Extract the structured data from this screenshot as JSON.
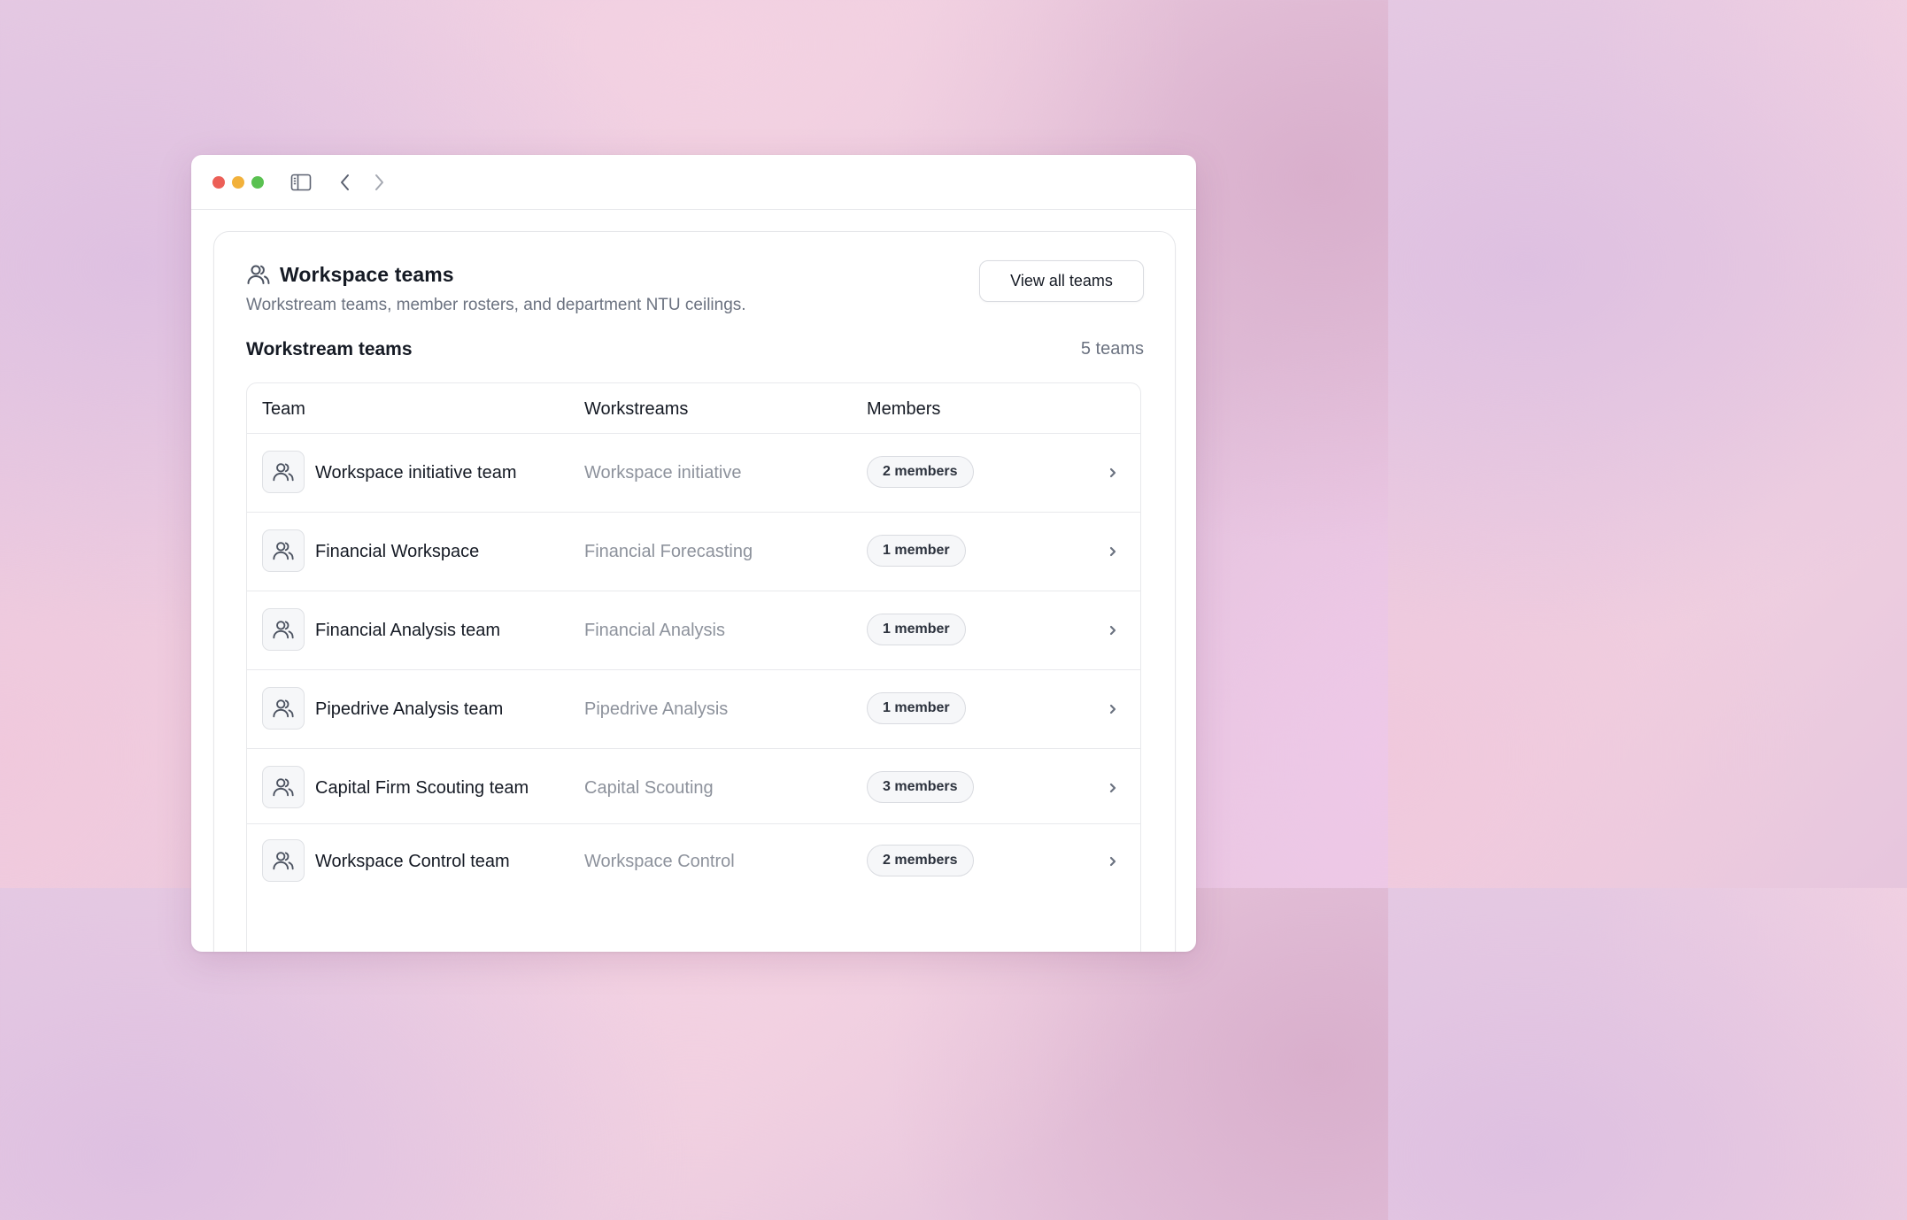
{
  "window": {
    "traffic_lights": [
      "close",
      "minimize",
      "zoom"
    ],
    "toolbar_icons": [
      "sidebar-toggle-icon",
      "chevron-left-icon",
      "chevron-right-icon"
    ]
  },
  "card": {
    "title": "Workspace teams",
    "subtitle": "Workstream teams, member rosters, and department NTU ceilings.",
    "view_all_label": "View all teams",
    "section_title": "Workstream teams",
    "team_count": "5 teams"
  },
  "table": {
    "columns": [
      "Team",
      "Workstreams",
      "Members"
    ],
    "rows": [
      {
        "team": "Workspace initiative team",
        "workstream": "Workspace initiative",
        "members": "2 members"
      },
      {
        "team": "Financial Workspace",
        "workstream": "Financial Forecasting",
        "members": "1 member"
      },
      {
        "team": "Financial Analysis team",
        "workstream": "Financial Analysis",
        "members": "1 member"
      },
      {
        "team": "Pipedrive Analysis team",
        "workstream": "Pipedrive Analysis",
        "members": "1 member"
      },
      {
        "team": "Capital Firm Scouting team",
        "workstream": "Capital Scouting",
        "members": "3 members"
      },
      {
        "team": "Workspace Control team",
        "workstream": "Workspace Control",
        "members": "2 members"
      }
    ]
  },
  "colors": {
    "close": "#ec5f57",
    "minimize": "#f2b13b",
    "zoom": "#5ac151",
    "text_primary": "#151a24",
    "text_muted": "#6b7280",
    "text_workstream": "#8d929c"
  }
}
